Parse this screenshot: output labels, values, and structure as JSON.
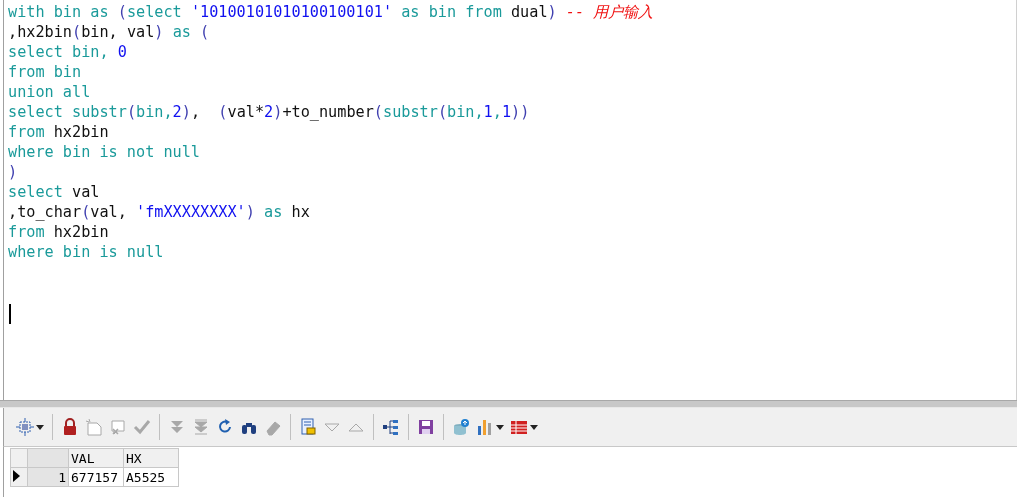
{
  "editor": {
    "lines": [
      {
        "tokens": [
          {
            "text": "with bin as ",
            "kind": "k"
          },
          {
            "text": "(",
            "kind": "o"
          },
          {
            "text": "select ",
            "kind": "k"
          },
          {
            "text": "'10100101010100100101'",
            "kind": "s"
          },
          {
            "text": " as bin from ",
            "kind": "k"
          },
          {
            "text": "dual",
            "kind": "p"
          },
          {
            "text": ")",
            "kind": "o"
          },
          {
            "text": " -- 用户输入",
            "kind": "c"
          }
        ]
      },
      {
        "tokens": [
          {
            "text": ",hx2bin",
            "kind": "p"
          },
          {
            "text": "(",
            "kind": "o"
          },
          {
            "text": "bin, val",
            "kind": "p"
          },
          {
            "text": ")",
            "kind": "o"
          },
          {
            "text": " as ",
            "kind": "k"
          },
          {
            "text": "(",
            "kind": "o"
          }
        ]
      },
      {
        "tokens": [
          {
            "text": "select bin, ",
            "kind": "k"
          },
          {
            "text": "0",
            "kind": "n"
          }
        ]
      },
      {
        "tokens": [
          {
            "text": "from bin",
            "kind": "k"
          }
        ]
      },
      {
        "tokens": [
          {
            "text": "union all",
            "kind": "k"
          }
        ]
      },
      {
        "tokens": [
          {
            "text": "select substr",
            "kind": "k"
          },
          {
            "text": "(",
            "kind": "o"
          },
          {
            "text": "bin,",
            "kind": "k"
          },
          {
            "text": "2",
            "kind": "n"
          },
          {
            "text": ")",
            "kind": "o"
          },
          {
            "text": ",  ",
            "kind": "p"
          },
          {
            "text": "(",
            "kind": "o"
          },
          {
            "text": "val*",
            "kind": "p"
          },
          {
            "text": "2",
            "kind": "n"
          },
          {
            "text": ")",
            "kind": "o"
          },
          {
            "text": "+to_number",
            "kind": "p"
          },
          {
            "text": "(",
            "kind": "o"
          },
          {
            "text": "substr",
            "kind": "k"
          },
          {
            "text": "(",
            "kind": "o"
          },
          {
            "text": "bin,",
            "kind": "k"
          },
          {
            "text": "1",
            "kind": "n"
          },
          {
            "text": ",",
            "kind": "k"
          },
          {
            "text": "1",
            "kind": "n"
          },
          {
            "text": "))",
            "kind": "o"
          }
        ]
      },
      {
        "tokens": [
          {
            "text": "from ",
            "kind": "k"
          },
          {
            "text": "hx2bin",
            "kind": "p"
          }
        ]
      },
      {
        "tokens": [
          {
            "text": "where bin is not null",
            "kind": "k"
          }
        ]
      },
      {
        "tokens": [
          {
            "text": ")",
            "kind": "o"
          }
        ]
      },
      {
        "tokens": [
          {
            "text": "select ",
            "kind": "k"
          },
          {
            "text": "val",
            "kind": "p"
          }
        ]
      },
      {
        "tokens": [
          {
            "text": ",to_char",
            "kind": "p"
          },
          {
            "text": "(",
            "kind": "o"
          },
          {
            "text": "val, ",
            "kind": "p"
          },
          {
            "text": "'fmXXXXXXXX'",
            "kind": "s"
          },
          {
            "text": ")",
            "kind": "o"
          },
          {
            "text": " as ",
            "kind": "k"
          },
          {
            "text": "hx",
            "kind": "p"
          }
        ]
      },
      {
        "tokens": [
          {
            "text": "from ",
            "kind": "k"
          },
          {
            "text": "hx2bin",
            "kind": "p"
          }
        ]
      },
      {
        "tokens": [
          {
            "text": "where bin is null",
            "kind": "k"
          }
        ]
      }
    ]
  },
  "toolbar": [
    {
      "kind": "select-rect",
      "disabled": false,
      "dropdown": true
    },
    {
      "kind": "sep"
    },
    {
      "kind": "lock",
      "disabled": false
    },
    {
      "kind": "new-doc",
      "disabled": true
    },
    {
      "kind": "delete-doc",
      "disabled": true
    },
    {
      "kind": "check",
      "disabled": true
    },
    {
      "kind": "sep"
    },
    {
      "kind": "down-double",
      "disabled": true
    },
    {
      "kind": "down-end",
      "disabled": true
    },
    {
      "kind": "refresh",
      "disabled": false
    },
    {
      "kind": "binoculars",
      "disabled": false
    },
    {
      "kind": "eraser",
      "disabled": true
    },
    {
      "kind": "sep"
    },
    {
      "kind": "form",
      "disabled": false
    },
    {
      "kind": "tri-down",
      "disabled": true
    },
    {
      "kind": "tri-up",
      "disabled": true
    },
    {
      "kind": "sep"
    },
    {
      "kind": "tree",
      "disabled": false
    },
    {
      "kind": "sep"
    },
    {
      "kind": "floppy",
      "disabled": false
    },
    {
      "kind": "sep"
    },
    {
      "kind": "database",
      "disabled": false
    },
    {
      "kind": "bar-chart",
      "disabled": false,
      "dropdown": true
    },
    {
      "kind": "table",
      "disabled": false,
      "dropdown": true
    }
  ],
  "grid": {
    "columns": [
      "VAL",
      "HX"
    ],
    "rows": [
      {
        "number": "1",
        "selected": true,
        "cells": [
          "677157",
          "A5525"
        ]
      }
    ]
  }
}
